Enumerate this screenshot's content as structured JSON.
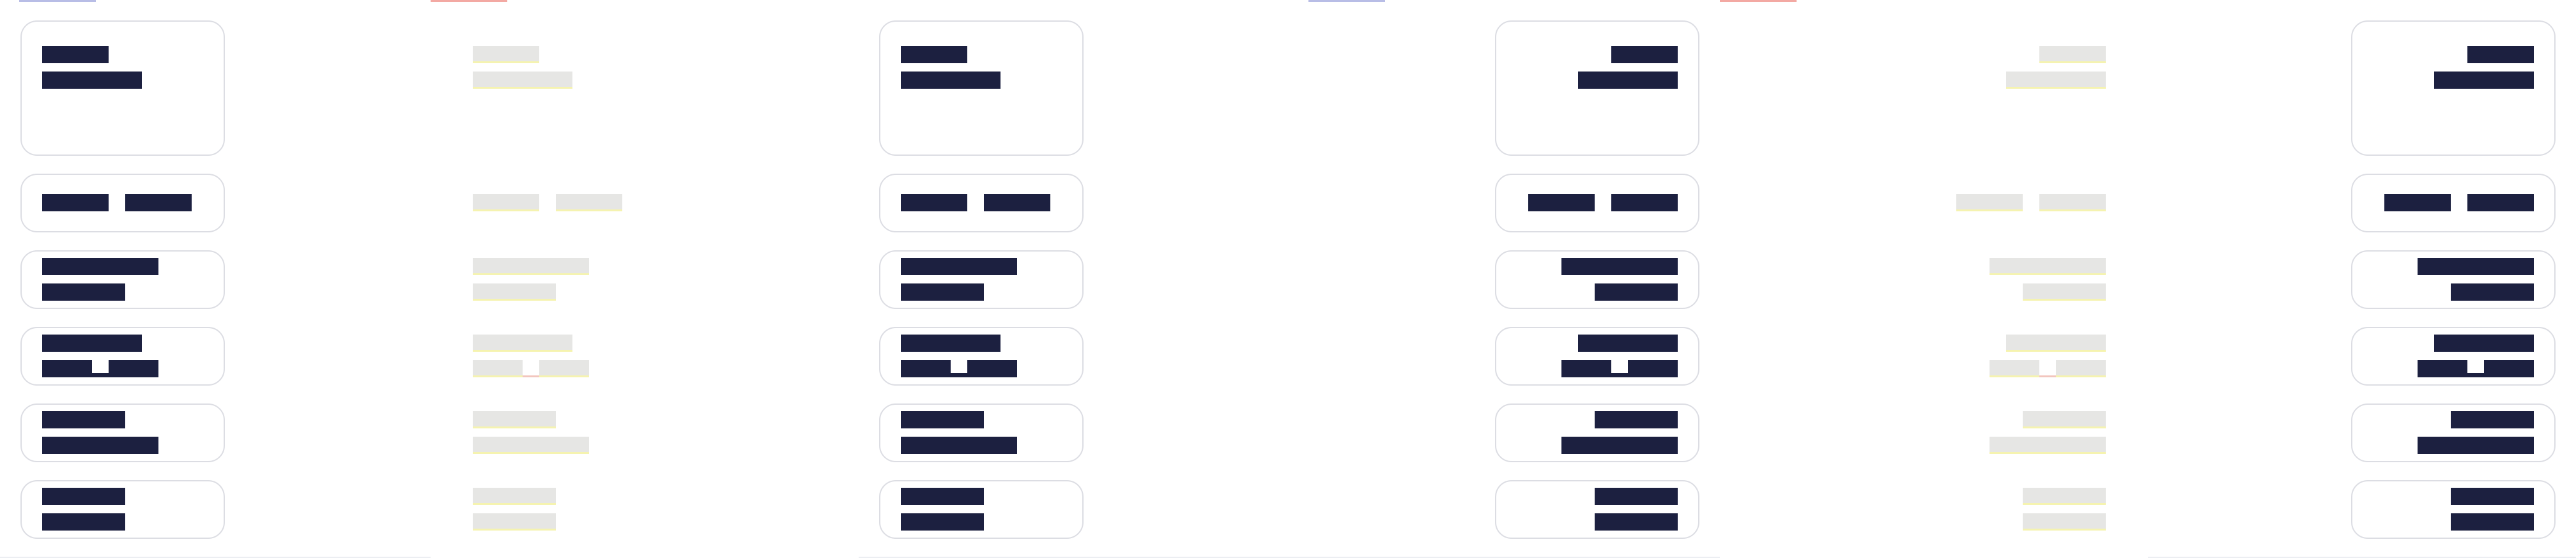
{
  "panels": [
    {
      "variant": "cards",
      "align": "left",
      "indicator": "#b8bde6"
    },
    {
      "variant": "ghost",
      "align": "left",
      "indicator": "#f3a9a3"
    },
    {
      "variant": "cards",
      "align": "left",
      "indicator": null
    },
    {
      "variant": "cards",
      "align": "right",
      "indicator": "#b8bde6"
    },
    {
      "variant": "ghost",
      "align": "right",
      "indicator": "#f3a9a3"
    },
    {
      "variant": "cards",
      "align": "right",
      "indicator": null
    }
  ],
  "colors": {
    "bar": "#1c2040",
    "ghost": "#e6e6e4",
    "ghost_underline": "#f5f3b0",
    "card_border": "#dcdde3",
    "indicator_blue": "#b8bde6",
    "indicator_red": "#f3a9a3"
  }
}
